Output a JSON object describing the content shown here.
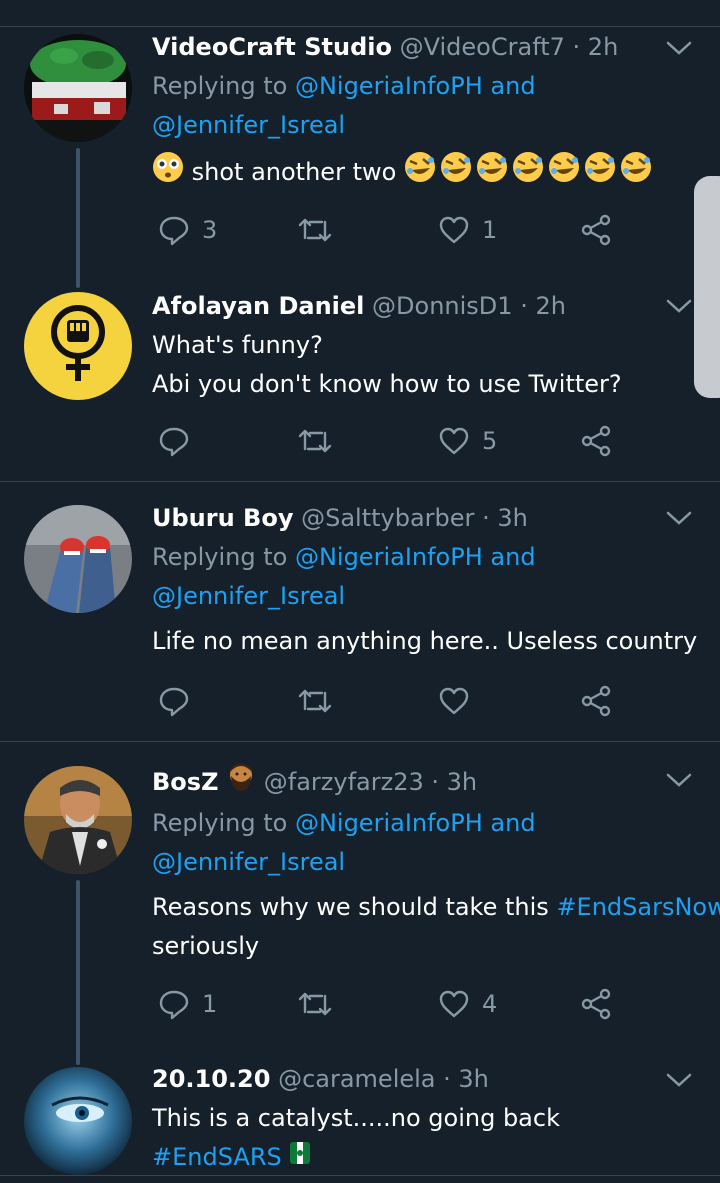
{
  "tweets": [
    {
      "name": "VideoCraft Studio",
      "handle": "@VideoCraft7",
      "time": "· 2h",
      "reply_prefix": "Replying to",
      "reply_user1": "@NigeriaInfoPH",
      "reply_and": "and",
      "reply_user2": "@Jennifer_Isreal",
      "text": "shot another two",
      "reply_count": "3",
      "retweet_count": "",
      "like_count": "1",
      "avatar_icon": "nigeria-flag-bucket-avatar"
    },
    {
      "name": "Afolayan Daniel",
      "handle": "@DonnisD1",
      "time": "· 2h",
      "text_line1": "What's funny?",
      "text_line2": "Abi you don't know how to use Twitter?",
      "reply_count": "",
      "retweet_count": "",
      "like_count": "5",
      "avatar_icon": "feminist-fist-avatar"
    },
    {
      "name": "Uburu Boy",
      "handle": "@Salttybarber",
      "time": "· 3h",
      "reply_prefix": "Replying to",
      "reply_user1": "@NigeriaInfoPH",
      "reply_and": "and",
      "reply_user2": "@Jennifer_Isreal",
      "text": "Life no mean anything here.. Useless country",
      "reply_count": "",
      "retweet_count": "",
      "like_count": "",
      "avatar_icon": "red-sneakers-avatar"
    },
    {
      "name": "BosZ",
      "handle": "@farzyfarz23",
      "time": "· 3h",
      "reply_prefix": "Replying to",
      "reply_user1": "@NigeriaInfoPH",
      "reply_and": "and",
      "reply_user2": "@Jennifer_Isreal",
      "text_pre": "Reasons why we should take this",
      "hashtag": "#EndSarsNow",
      "text_line2": "seriously",
      "reply_count": "1",
      "retweet_count": "",
      "like_count": "4",
      "avatar_icon": "man-portrait-avatar"
    },
    {
      "name": "20.10.20",
      "handle": "@caramelela",
      "time": "· 3h",
      "text": "This is a catalyst.....no going back",
      "hashtag": "#EndSARS",
      "avatar_icon": "blue-eye-avatar"
    }
  ],
  "colors": {
    "background": "#15202b",
    "link": "#1da1f2",
    "muted": "#8899a6",
    "divider": "#38444d"
  }
}
